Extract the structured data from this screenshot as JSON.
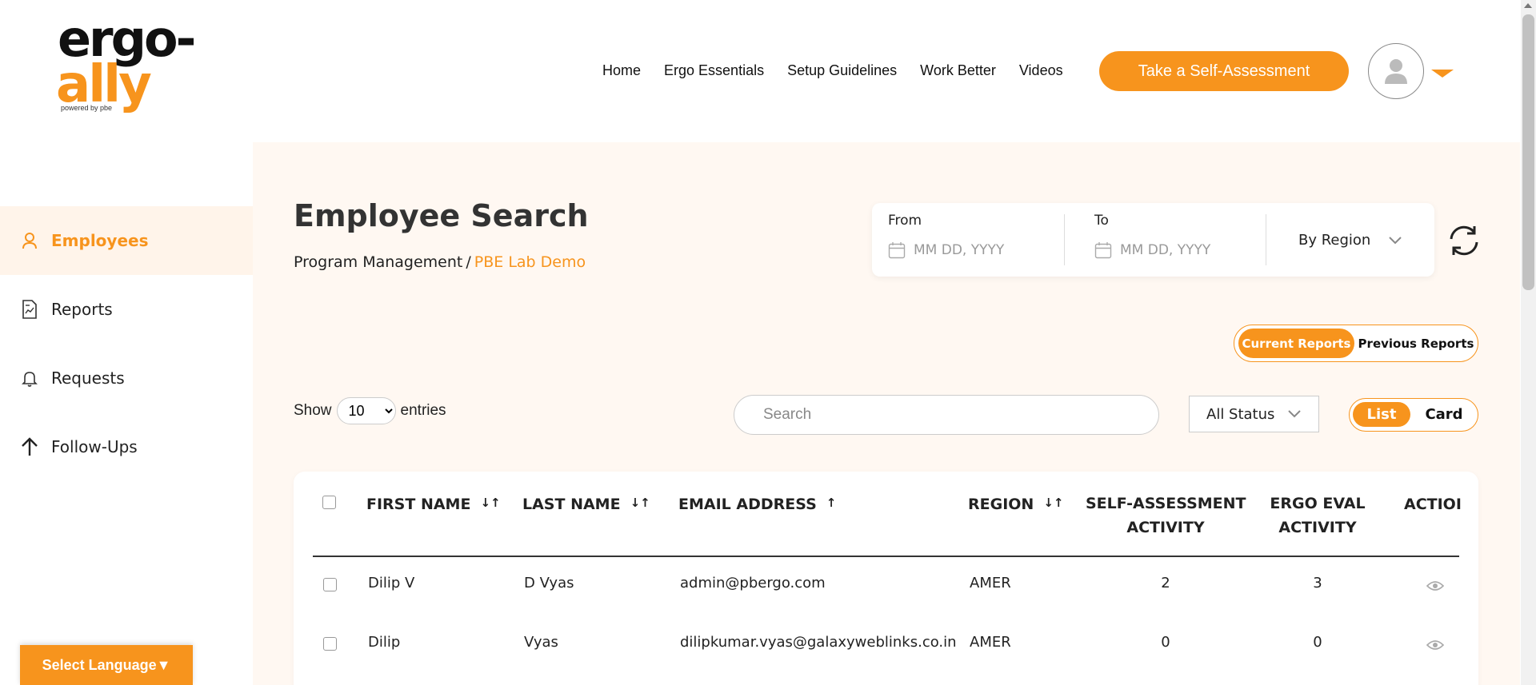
{
  "brand": {
    "line1": "ergo-",
    "line2": "ally",
    "tagline": "powered by pbe",
    "accent": "#f7941d"
  },
  "nav": {
    "items": [
      "Home",
      "Ergo Essentials",
      "Setup Guidelines",
      "Work Better",
      "Videos"
    ]
  },
  "header": {
    "cta_label": "Take a Self-Assessment"
  },
  "sidebar": {
    "items": [
      {
        "label": "Employees",
        "icon": "user-icon",
        "active": true
      },
      {
        "label": "Reports",
        "icon": "report-icon"
      },
      {
        "label": "Requests",
        "icon": "bell-icon"
      },
      {
        "label": "Follow-Ups",
        "icon": "arrow-up-icon"
      }
    ],
    "language_label": "Select Language▼"
  },
  "page": {
    "title": "Employee Search",
    "breadcrumb": {
      "parent": "Program Management",
      "separator": "/",
      "current": "PBE Lab Demo"
    }
  },
  "filters": {
    "from_label": "From",
    "from_placeholder": "MM DD, YYYY",
    "to_label": "To",
    "to_placeholder": "MM DD, YYYY",
    "region_label": "By Region",
    "report_toggle": {
      "current": "Current Reports",
      "previous": "Previous Reports",
      "selected": "Current Reports"
    },
    "show_label": "Show",
    "entries_value": "10",
    "entries_label": "entries",
    "search_placeholder": "Search",
    "status_label": "All Status",
    "view_toggle": {
      "list": "List",
      "card": "Card",
      "selected": "List"
    }
  },
  "table": {
    "columns": [
      {
        "label": "FIRST NAME",
        "sort": "both"
      },
      {
        "label": "LAST NAME",
        "sort": "both"
      },
      {
        "label": "EMAIL ADDRESS",
        "sort": "asc"
      },
      {
        "label": "REGION",
        "sort": "both"
      },
      {
        "label_line1": "SELF-ASSESSMENT",
        "label_line2": "ACTIVITY"
      },
      {
        "label_line1": "ERGO EVAL",
        "label_line2": "ACTIVITY"
      },
      {
        "label": "ACTIOI"
      }
    ],
    "rows": [
      {
        "first": "Dilip V",
        "last": "D Vyas",
        "email": "admin@pbergo.com",
        "region": "AMER",
        "self_assessment": "2",
        "ergo_eval": "3"
      },
      {
        "first": "Dilip",
        "last": "Vyas",
        "email": "dilipkumar.vyas@galaxyweblinks.co.in",
        "region": "AMER",
        "self_assessment": "0",
        "ergo_eval": "0"
      }
    ],
    "sort_glyphs": {
      "both": "↓↑",
      "asc": "↑"
    }
  }
}
